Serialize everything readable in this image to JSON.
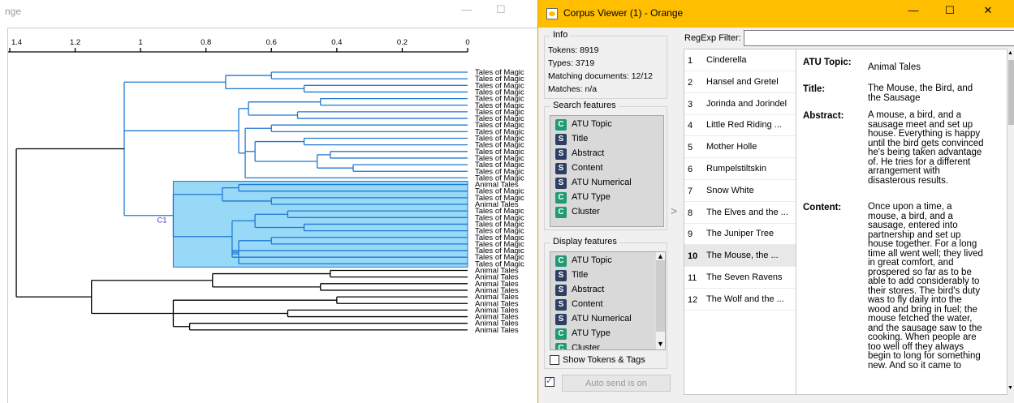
{
  "left_window": {
    "title_partial": "nge",
    "controls": {
      "minimize": "—",
      "maximize": "☐"
    },
    "axis": {
      "ticks": [
        "1.4",
        "1.2",
        "1",
        "0.8",
        "0.6",
        "0.4",
        "0.2",
        "0"
      ]
    },
    "cluster_label": "C1",
    "leaf_labels": [
      "Tales of Magic",
      "Tales of Magic",
      "Tales of Magic",
      "Tales of Magic",
      "Tales of Magic",
      "Tales of Magic",
      "Tales of Magic",
      "Tales of Magic",
      "Tales of Magic",
      "Tales of Magic",
      "Tales of Magic",
      "Tales of Magic",
      "Tales of Magic",
      "Tales of Magic",
      "Tales of Magic",
      "Tales of Magic",
      "Tales of Magic",
      "Animal Tales",
      "Tales of Magic",
      "Tales of Magic",
      "Animal Tales",
      "Tales of Magic",
      "Tales of Magic",
      "Tales of Magic",
      "Tales of Magic",
      "Tales of Magic",
      "Tales of Magic",
      "Tales of Magic",
      "Tales of Magic",
      "Tales of Magic",
      "Animal Tales",
      "Animal Tales",
      "Animal Tales",
      "Animal Tales",
      "Animal Tales",
      "Animal Tales",
      "Animal Tales",
      "Animal Tales",
      "Animal Tales",
      "Animal Tales"
    ],
    "colors": {
      "blue": "#1e78d2",
      "cluster_fill": "#99d9f8",
      "cluster_label": "#3a3acc"
    }
  },
  "corpus_viewer": {
    "title": "Corpus Viewer (1) - Orange",
    "controls": {
      "minimize": "—",
      "maximize": "☐",
      "close": "✕"
    },
    "title_bar_color": "#ffbf00",
    "info": {
      "legend": "Info",
      "tokens": "Tokens: 8919",
      "types": "Types: 3719",
      "matching": "Matching documents: 12/12",
      "matches": "Matches: n/a"
    },
    "search_features": {
      "legend": "Search features",
      "items": [
        {
          "badge": "C",
          "kind": "c",
          "label": "ATU Topic"
        },
        {
          "badge": "S",
          "kind": "s",
          "label": "Title"
        },
        {
          "badge": "S",
          "kind": "s",
          "label": "Abstract"
        },
        {
          "badge": "S",
          "kind": "s",
          "label": "Content"
        },
        {
          "badge": "S",
          "kind": "s",
          "label": "ATU Numerical"
        },
        {
          "badge": "C",
          "kind": "c",
          "label": "ATU Type"
        },
        {
          "badge": "C",
          "kind": "c",
          "label": "Cluster"
        }
      ]
    },
    "display_features": {
      "legend": "Display features",
      "items": [
        {
          "badge": "C",
          "kind": "c",
          "label": "ATU Topic"
        },
        {
          "badge": "S",
          "kind": "s",
          "label": "Title"
        },
        {
          "badge": "S",
          "kind": "s",
          "label": "Abstract"
        },
        {
          "badge": "S",
          "kind": "s",
          "label": "Content"
        },
        {
          "badge": "S",
          "kind": "s",
          "label": "ATU Numerical"
        },
        {
          "badge": "C",
          "kind": "c",
          "label": "ATU Type"
        },
        {
          "badge": "C",
          "kind": "c",
          "label": "Cluster"
        }
      ]
    },
    "show_tokens_label": "Show Tokens & Tags",
    "auto_send_label": "Auto send is on",
    "splitter_arrow": ">",
    "filter_label": "RegExp Filter:",
    "filter_value": "",
    "documents": [
      {
        "num": "1",
        "title": "Cinderella"
      },
      {
        "num": "2",
        "title": "Hansel and Gretel"
      },
      {
        "num": "3",
        "title": "Jorinda and Jorindel"
      },
      {
        "num": "4",
        "title": "Little Red Riding ..."
      },
      {
        "num": "5",
        "title": "Mother Holle"
      },
      {
        "num": "6",
        "title": "Rumpelstiltskin"
      },
      {
        "num": "7",
        "title": "Snow White"
      },
      {
        "num": "8",
        "title": "The Elves and the ..."
      },
      {
        "num": "9",
        "title": "The Juniper Tree"
      },
      {
        "num": "10",
        "title": "The Mouse, the ..."
      },
      {
        "num": "11",
        "title": "The Seven Ravens"
      },
      {
        "num": "12",
        "title": "The Wolf and the ..."
      }
    ],
    "selected_index": 9,
    "doc_fields": {
      "topic_name": "ATU Topic:",
      "topic_value": "Animal Tales",
      "title_name": "Title:",
      "title_value": [
        "The Mouse, the Bird, and",
        "the Sausage"
      ],
      "abstract_name": "Abstract:",
      "abstract_value": [
        "A mouse, a bird, and a",
        "sausage meet and set up",
        "house. Everything is happy",
        "until the bird gets convinced",
        "he's being taken advantage",
        "of. He tries for a different",
        "arrangement with",
        "disasterous results."
      ],
      "content_name": "Content:",
      "content_value": [
        "Once upon a time, a",
        "mouse, a bird, and a",
        "sausage, entered into",
        "partnership and set up",
        "house together. For a long",
        "time all went well; they lived",
        "in great comfort, and",
        "prospered so far as to be",
        "able to add considerably to",
        "their stores. The bird's duty",
        "was to fly daily into the",
        "wood and bring in fuel; the",
        "mouse fetched the water,",
        "and the sausage saw to the",
        "cooking. When people are",
        "too well off they always",
        "begin to long for something",
        "new. And so it came to"
      ]
    }
  }
}
